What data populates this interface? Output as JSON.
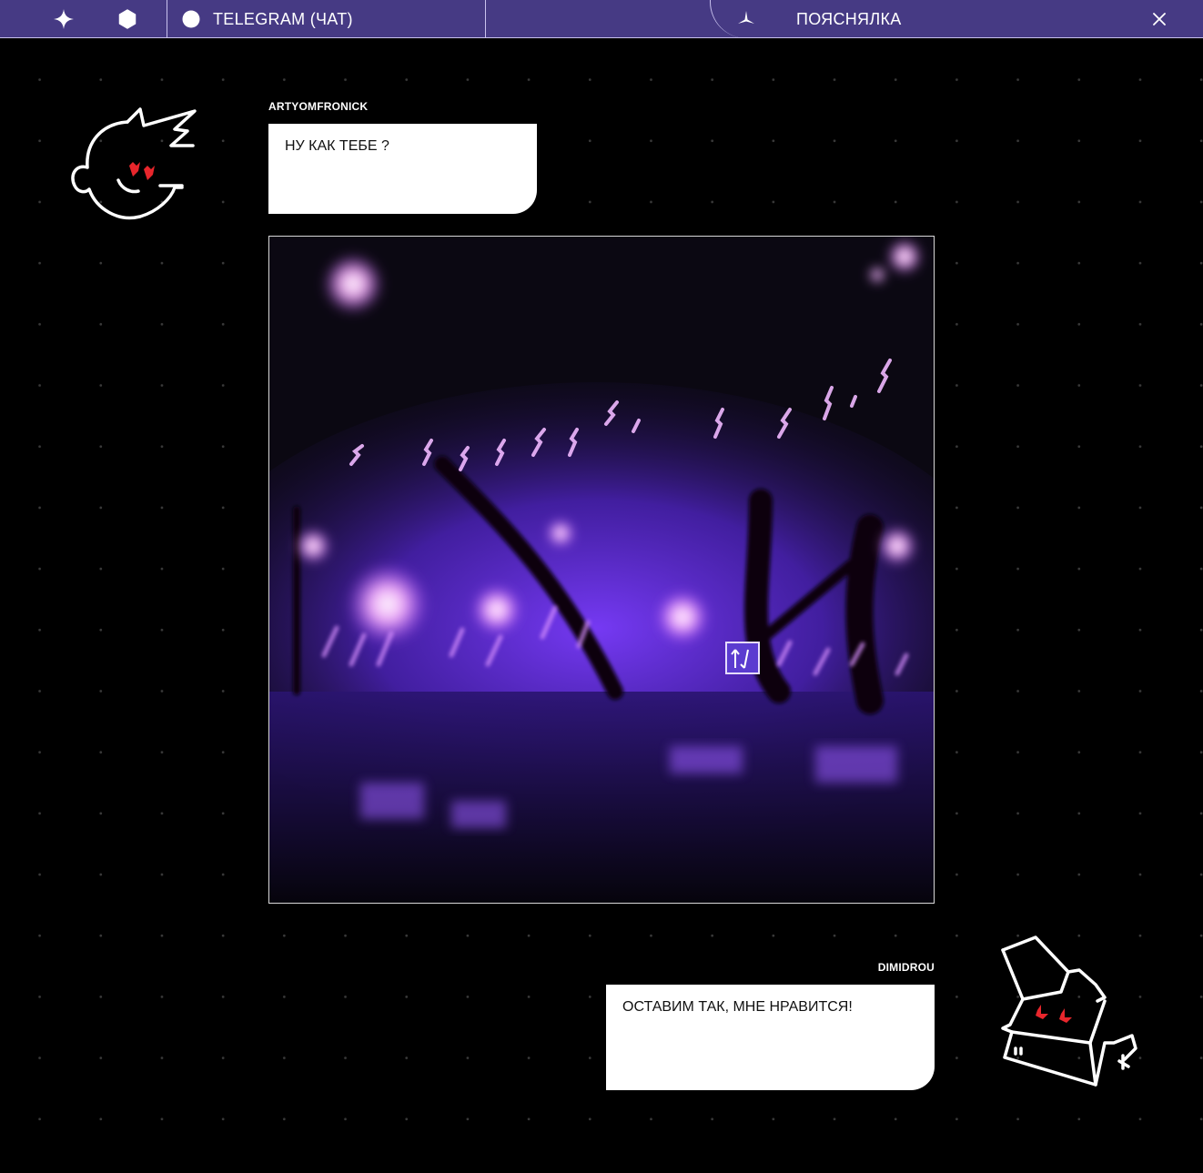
{
  "topbar": {
    "chat_tab_label": "TELEGRAM (ЧАТ)",
    "panel_title": "ПОЯСНЯЛКА"
  },
  "messages": [
    {
      "author": "ARTYOMFRONICK",
      "text": "НУ КАК ТЕБЕ ?"
    },
    {
      "author": "DIMIDROU",
      "text": "ОСТАВИМ ТАК, МНЕ НРАВИТСЯ!"
    }
  ],
  "colors": {
    "topbar_bg": "#463a84",
    "topbar_border": "#c9c2ee",
    "page_bg": "#000000",
    "bubble_bg": "#ffffff",
    "heart": "#e8262c",
    "photo_glow": "#7b3cff"
  },
  "icons": {
    "left_1": "sparkle-icon",
    "left_2": "hexagon-icon",
    "tab": "circle-icon",
    "panel": "tri-star-icon",
    "close": "close-icon"
  }
}
